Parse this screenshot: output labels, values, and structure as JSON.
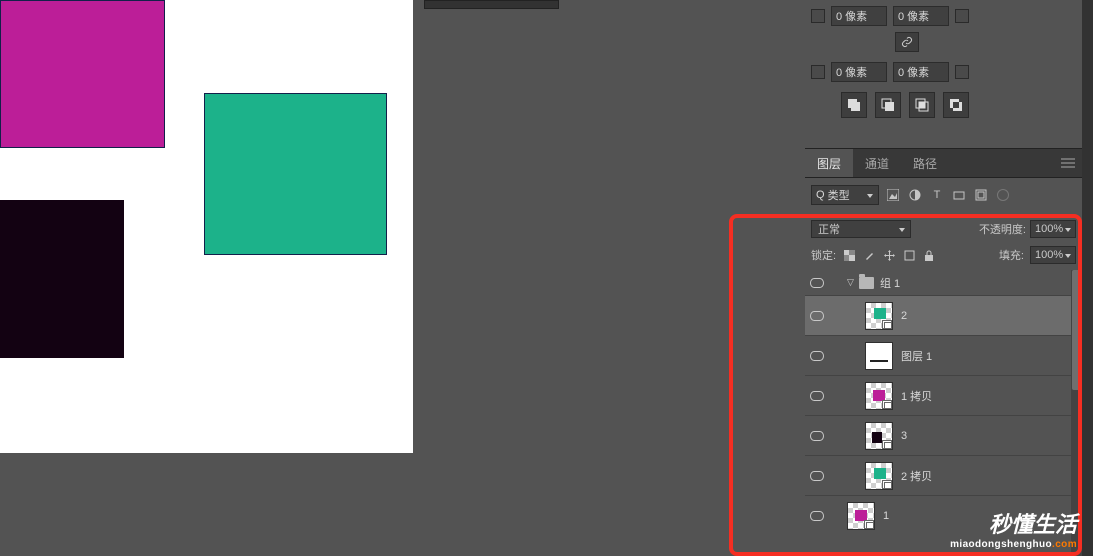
{
  "canvas": {
    "shapes": {
      "magenta": "#bc1e98",
      "green": "#1cb28a",
      "black": "#130212"
    }
  },
  "props": {
    "row1": {
      "v1": "0 像素",
      "v2": "0 像素"
    },
    "row2": {
      "v1": "0 像素",
      "v2": "0 像素"
    },
    "link_icon": "link-icon"
  },
  "panel_tabs": {
    "layers": "图层",
    "channels": "通道",
    "paths": "路径"
  },
  "filter": {
    "search_prefix": "Q",
    "kind": "类型"
  },
  "blend": {
    "mode": "正常",
    "opacity_label": "不透明度:",
    "opacity_value": "100%"
  },
  "lock": {
    "label": "锁定:",
    "fill_label": "填充:",
    "fill_value": "100%"
  },
  "group": {
    "name": "组 1"
  },
  "layers": [
    {
      "name": "2"
    },
    {
      "name": "图层 1"
    },
    {
      "name": "1 拷贝"
    },
    {
      "name": "3"
    },
    {
      "name": "2 拷贝"
    },
    {
      "name": "1"
    }
  ],
  "watermark": {
    "big": "秒懂生活",
    "small_pre": "miaodongshenghuo",
    "small_suf": ".com"
  }
}
